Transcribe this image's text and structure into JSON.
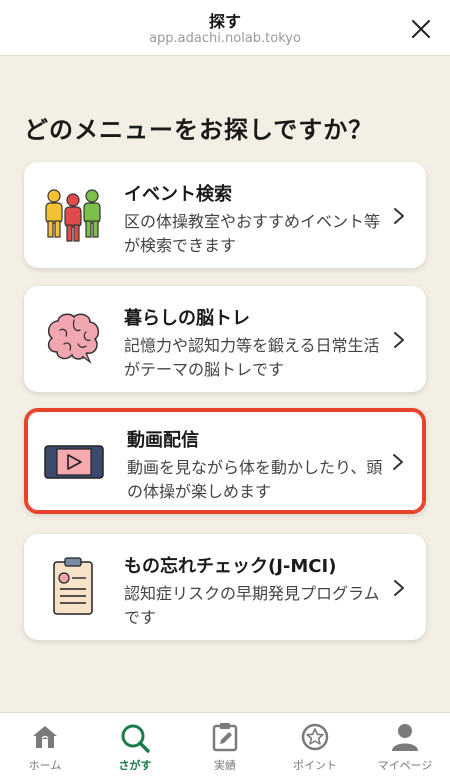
{
  "header": {
    "title": "探す",
    "url": "app.adachi.nolab.tokyo"
  },
  "heading": "どのメニューをお探しですか？",
  "cards": [
    {
      "title": "イベント検索",
      "desc": "区の体操教室やおすすめイベント等が検索できます",
      "icon": "people-icon",
      "highlighted": false
    },
    {
      "title": "暮らしの脳トレ",
      "desc": "記憶力や認知力等を鍛える日常生活がテーマの脳トレです",
      "icon": "brain-icon",
      "highlighted": false
    },
    {
      "title": "動画配信",
      "desc": "動画を見ながら体を動かしたり、頭の体操が楽しめます",
      "icon": "video-player-icon",
      "highlighted": true
    },
    {
      "title": "もの忘れチェック(J-MCI)",
      "desc": "認知症リスクの早期発見プログラムです",
      "icon": "clipboard-icon",
      "highlighted": false
    }
  ],
  "tabs": [
    {
      "label": "ホーム",
      "icon": "home-icon",
      "active": false
    },
    {
      "label": "さがす",
      "icon": "search-icon",
      "active": true
    },
    {
      "label": "実績",
      "icon": "clipboard-pen-icon",
      "active": false
    },
    {
      "label": "ポイント",
      "icon": "star-coin-icon",
      "active": false
    },
    {
      "label": "マイページ",
      "icon": "person-icon",
      "active": false
    }
  ],
  "colors": {
    "background": "#f3efe4",
    "accent_green": "#1d7a4b",
    "highlight_red": "#e8422c"
  }
}
